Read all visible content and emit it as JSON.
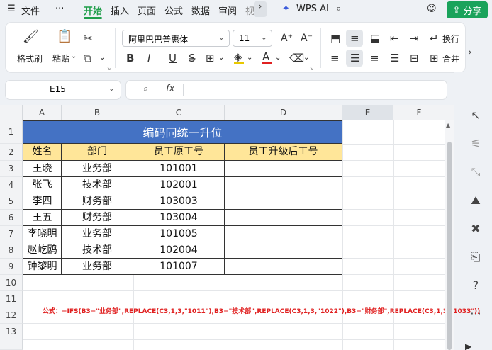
{
  "menubar": {
    "hamburger": "☰",
    "file": "文件",
    "more": "···",
    "tabs": [
      "开始",
      "插入",
      "页面",
      "公式",
      "数据",
      "审阅",
      "视"
    ],
    "wps_ai": "WPS AI",
    "share": "分享"
  },
  "ribbon": {
    "format_painter": "格式刷",
    "paste": "粘贴",
    "font_name": "阿里巴巴普惠体",
    "font_size": "11",
    "bold": "B",
    "italic": "I",
    "underline": "U",
    "wrap": "换行",
    "merge": "合并"
  },
  "formula_bar": {
    "name_box": "E15",
    "fx": "fx",
    "formula": ""
  },
  "sheet": {
    "columns": [
      "A",
      "B",
      "C",
      "D",
      "E",
      "F"
    ],
    "rows": [
      "1",
      "2",
      "3",
      "4",
      "5",
      "6",
      "7",
      "8",
      "9",
      "10",
      "11",
      "12",
      "13"
    ],
    "title": "编码同统一升位",
    "headers": [
      "姓名",
      "部门",
      "员工原工号",
      "员工升级后工号"
    ],
    "data": [
      [
        "王晓",
        "业务部",
        "101001",
        ""
      ],
      [
        "张飞",
        "技术部",
        "102001",
        ""
      ],
      [
        "李四",
        "财务部",
        "103003",
        ""
      ],
      [
        "王五",
        "财务部",
        "103004",
        ""
      ],
      [
        "李晓明",
        "业务部",
        "101005",
        ""
      ],
      [
        "赵屹鸥",
        "技术部",
        "102004",
        ""
      ],
      [
        "钟黎明",
        "业务部",
        "101007",
        ""
      ]
    ],
    "formula_note": "公式：=IFS(B3=\"业务部\",REPLACE(C3,1,3,\"1011\"),B3=\"技术部\",REPLACE(C3,1,3,\"1022\"),B3=\"财务部\",REPLACE(C3,1,3,\"1033\"))"
  },
  "colors": {
    "accent": "#1f9e4a",
    "title_fill": "#4472c4",
    "header_fill": "#ffe699",
    "note_red": "#e02020"
  }
}
